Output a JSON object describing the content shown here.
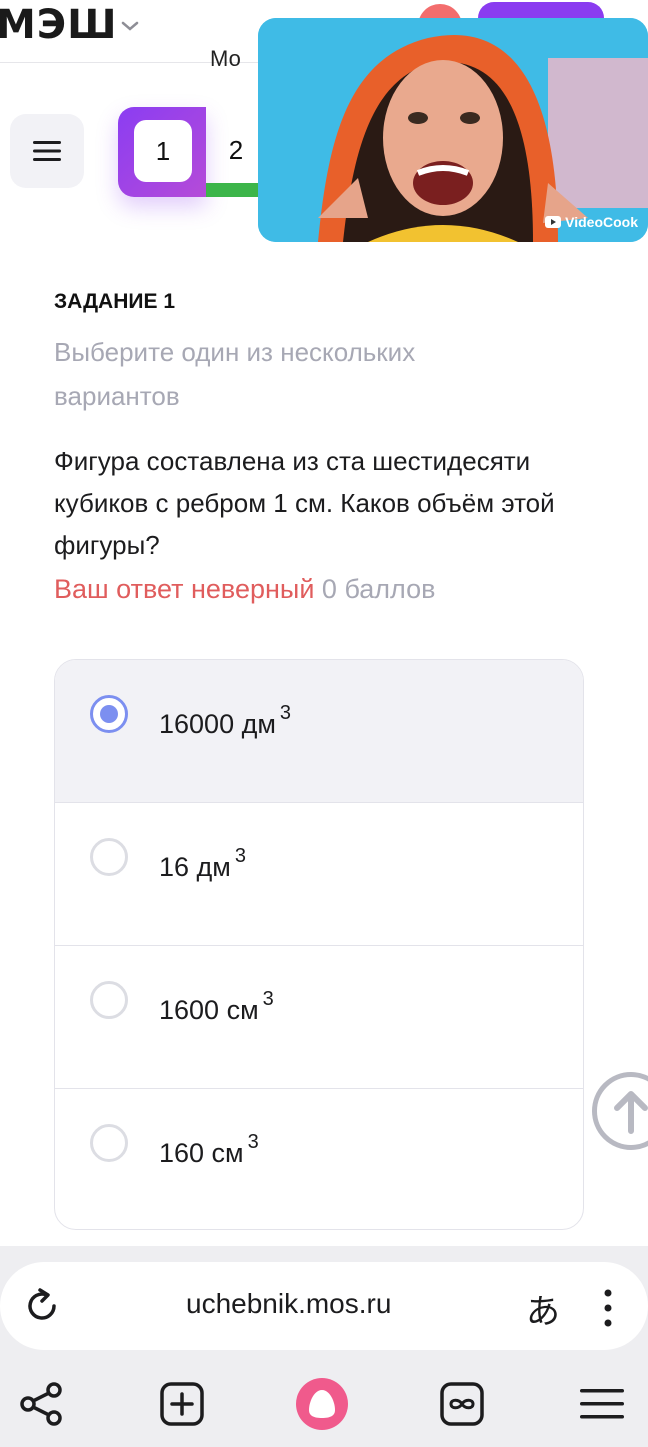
{
  "header": {
    "logo": "МЭШ",
    "partial_text": "Мо"
  },
  "nav": {
    "tabs": [
      {
        "label": "1"
      },
      {
        "label": "2"
      }
    ]
  },
  "video": {
    "label": "VideoCook"
  },
  "task": {
    "label": "ЗАДАНИЕ 1",
    "hint": "Выберите один из нескольких вариантов",
    "question": "Фигура составлена из ста шестидесяти кубиков с ребром 1 см. Каков объём этой фигуры?",
    "result_wrong": "Ваш ответ неверный",
    "result_score": "0 баллов"
  },
  "options": [
    {
      "text": "16000 дм",
      "exp": "3",
      "selected": true
    },
    {
      "text": "16 дм",
      "exp": "3",
      "selected": false
    },
    {
      "text": "1600 см",
      "exp": "3",
      "selected": false
    },
    {
      "text": "160 см",
      "exp": "3",
      "selected": false
    }
  ],
  "browser": {
    "url": "uchebnik.mos.ru",
    "translate_glyph": "あ"
  },
  "colors": {
    "accent_purple": "#8a3cf0",
    "correct_green": "#3cb54a",
    "wrong_red": "#e05d5d",
    "radio_blue": "#7c8ff0",
    "alice_pink": "#f05a8c"
  }
}
